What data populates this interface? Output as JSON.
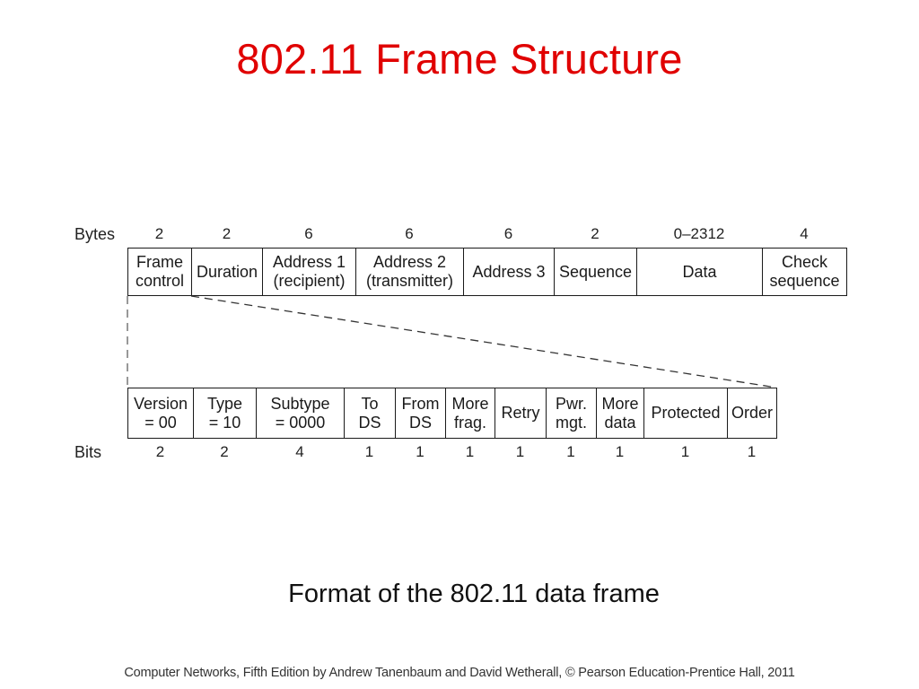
{
  "title": "802.11 Frame Structure",
  "frame": {
    "row_label": "Bytes",
    "fields": [
      {
        "label": "Frame\ncontrol",
        "size": "2"
      },
      {
        "label": "Duration",
        "size": "2"
      },
      {
        "label": "Address 1\n(recipient)",
        "size": "6"
      },
      {
        "label": "Address 2\n(transmitter)",
        "size": "6"
      },
      {
        "label": "Address 3",
        "size": "6"
      },
      {
        "label": "Sequence",
        "size": "2"
      },
      {
        "label": "Data",
        "size": "0–2312"
      },
      {
        "label": "Check\nsequence",
        "size": "4"
      }
    ]
  },
  "frame_control": {
    "row_label": "Bits",
    "fields": [
      {
        "label": "Version\n= 00",
        "size": "2"
      },
      {
        "label": "Type\n= 10",
        "size": "2"
      },
      {
        "label": "Subtype\n= 0000",
        "size": "4"
      },
      {
        "label": "To\nDS",
        "size": "1"
      },
      {
        "label": "From\nDS",
        "size": "1"
      },
      {
        "label": "More\nfrag.",
        "size": "1"
      },
      {
        "label": "Retry",
        "size": "1"
      },
      {
        "label": "Pwr.\nmgt.",
        "size": "1"
      },
      {
        "label": "More\ndata",
        "size": "1"
      },
      {
        "label": "Protected",
        "size": "1"
      },
      {
        "label": "Order",
        "size": "1"
      }
    ]
  },
  "caption": "Format of the 802.11 data frame",
  "credit": "Computer Networks, Fifth Edition by Andrew Tanenbaum and David Wetherall, © Pearson Education-Prentice Hall, 2011",
  "colors": {
    "title": "#e00000",
    "lines": "#1a1a1a"
  }
}
